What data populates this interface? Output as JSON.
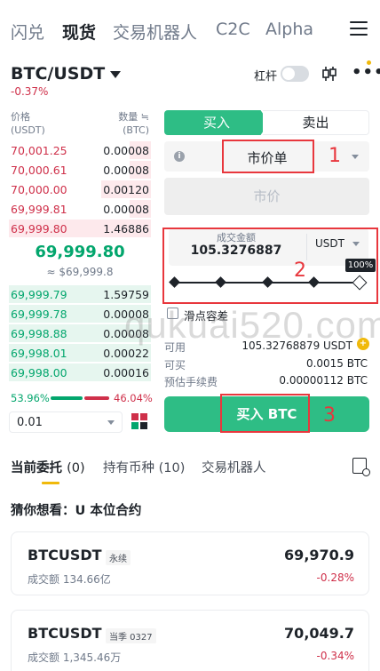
{
  "nav": {
    "tabs": [
      {
        "label": "闪兑",
        "active": false
      },
      {
        "label": "现货",
        "active": true
      },
      {
        "label": "交易机器人",
        "active": false
      },
      {
        "label": "C2C",
        "active": false
      },
      {
        "label": "Alpha",
        "active": false
      }
    ]
  },
  "pair": {
    "symbol": "BTC/USDT",
    "change": "-0.37%",
    "leverage_label": "杠杆"
  },
  "orderbook": {
    "price_header": "价格",
    "price_unit": "(USDT)",
    "qty_header": "数量 ≒",
    "qty_unit": "(BTC)",
    "asks": [
      {
        "price": "70,001.25",
        "qty": "0.00008",
        "depth": 0.15
      },
      {
        "price": "70,000.61",
        "qty": "0.00008",
        "depth": 0.15
      },
      {
        "price": "70,000.00",
        "qty": "0.00120",
        "depth": 0.35
      },
      {
        "price": "69,999.81",
        "qty": "0.00008",
        "depth": 0.15
      },
      {
        "price": "69,999.80",
        "qty": "1.46886",
        "depth": 1.0
      }
    ],
    "last_price": "69,999.80",
    "last_fiat": "≈ $69,999.8",
    "bids": [
      {
        "price": "69,999.79",
        "qty": "1.59759",
        "depth": 1.0
      },
      {
        "price": "69,999.78",
        "qty": "0.00008",
        "depth": 1.0
      },
      {
        "price": "69,998.88",
        "qty": "0.00008",
        "depth": 1.0
      },
      {
        "price": "69,998.01",
        "qty": "0.00022",
        "depth": 1.0
      },
      {
        "price": "69,998.00",
        "qty": "0.00016",
        "depth": 1.0
      }
    ],
    "buy_ratio": "53.96%",
    "sell_ratio": "46.04%",
    "precision": "0.01"
  },
  "form": {
    "buy_tab": "买入",
    "sell_tab": "卖出",
    "order_type": "市价单",
    "market_placeholder": "市价",
    "amount_label": "成交金额",
    "amount_value": "105.3276887",
    "amount_unit": "USDT",
    "slider_percent": "100%",
    "slippage_label": "滑点容差",
    "available_label": "可用",
    "available_value": "105.32768879 USDT",
    "can_buy_label": "可买",
    "can_buy_value": "0.0015 BTC",
    "fee_label": "预估手续费",
    "fee_value": "0.00000112 BTC",
    "buy_button": "买入 BTC"
  },
  "annotations": {
    "step1": "1",
    "step2": "2",
    "step3": "3"
  },
  "watermark": "qukuai520.com",
  "bottom_tabs": [
    {
      "label": "当前委托",
      "count": "(0)",
      "active": true
    },
    {
      "label": "持有币种",
      "count": "(10)",
      "active": false
    },
    {
      "label": "交易机器人",
      "count": "",
      "active": false
    }
  ],
  "guess_title": "猜你想看：U 本位合约",
  "cards": [
    {
      "symbol": "BTCUSDT",
      "tag": "永续",
      "volume": "成交额 134.66亿",
      "price": "69,970.9",
      "change": "-0.28%"
    },
    {
      "symbol": "BTCUSDT",
      "tag": "当季 0327",
      "volume": "成交额 1,345.46万",
      "price": "70,049.7",
      "change": "-0.34%"
    }
  ],
  "colors": {
    "green": "#2ebd85",
    "red": "#cf304a",
    "accent": "#f0b90b",
    "annotation": "#e8373d"
  }
}
